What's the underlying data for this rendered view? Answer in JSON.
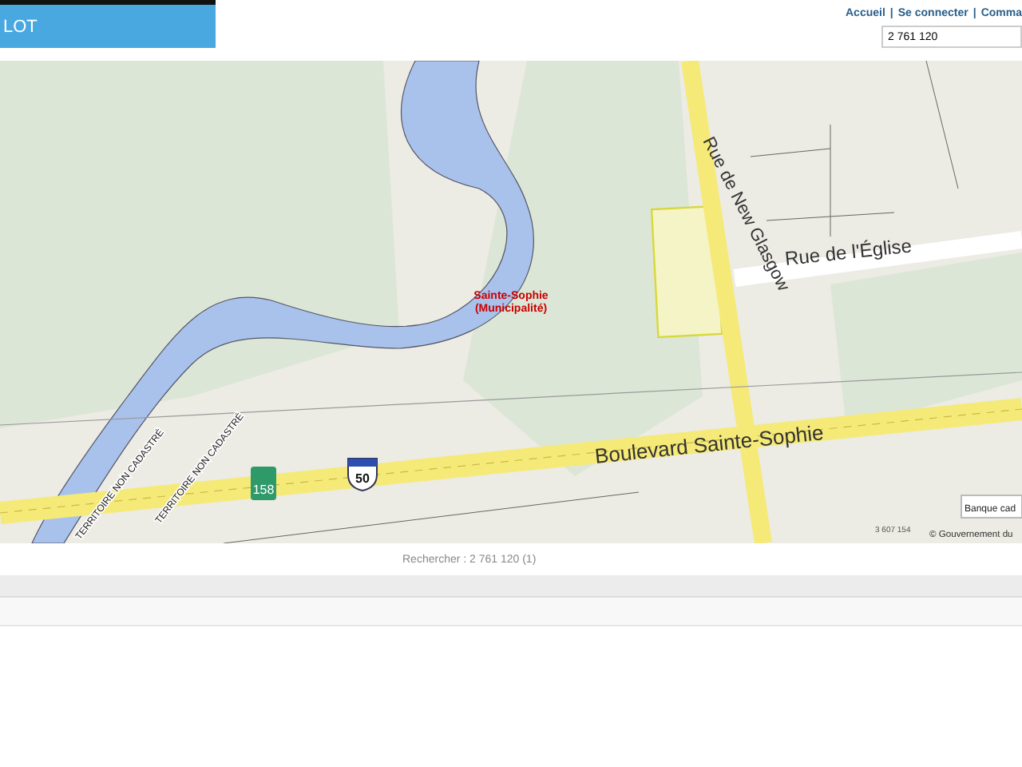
{
  "header": {
    "title": "LOT",
    "links": [
      {
        "text": "Accueil",
        "separator": "|"
      },
      {
        "text": "Se connecter",
        "separator": "|"
      },
      {
        "text": "Comma"
      }
    ],
    "search": {
      "value": "2 761 120"
    }
  },
  "map": {
    "labels": [
      {
        "kind": "street",
        "text": "Rue de New Glasgow"
      },
      {
        "kind": "street",
        "text": "Rue de l'Église"
      },
      {
        "kind": "street",
        "text": "Boulevard Sainte-Sophie"
      },
      {
        "kind": "place",
        "text": "Sainte-Sophie"
      },
      {
        "kind": "place",
        "text": "(Municipalité)"
      },
      {
        "kind": "territory",
        "text": "TERRITOIRE NON CADASTRÉ"
      },
      {
        "kind": "territory",
        "text": "TERRITOIRE NON CADASTRÉ"
      },
      {
        "kind": "lot",
        "text": "3 607 154"
      }
    ],
    "shields": [
      {
        "kind": "route",
        "text": "158"
      },
      {
        "kind": "highway",
        "text": "50"
      }
    ],
    "controls": [
      {
        "kind": "button",
        "text": "Banque cad"
      }
    ],
    "attribution": "© Gouvernement du"
  },
  "result": "Rechercher : 2 761 120 (1)"
}
